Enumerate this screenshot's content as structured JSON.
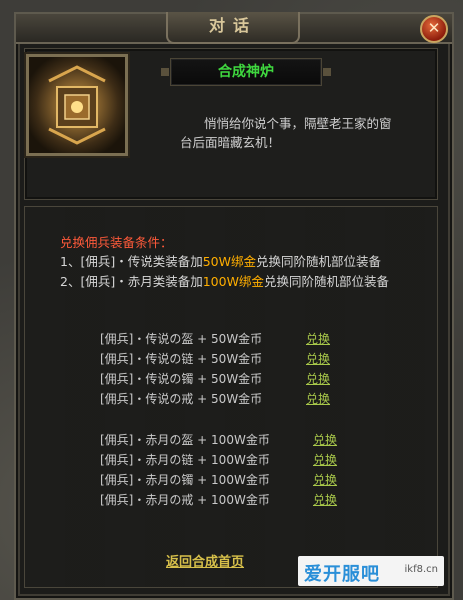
{
  "window": {
    "title": "对话",
    "close_glyph": "✕"
  },
  "npc": {
    "name": "合成神炉",
    "speech": "悄悄给你说个事，隔壁老王家的窗台后面暗藏玄机！",
    "portrait_icon": "treasure-furnace-icon"
  },
  "conditions": {
    "title": "兑换佣兵装备条件：",
    "lines": [
      {
        "prefix": "1、[佣兵]・传说类装备加",
        "highlight": "50W绑金",
        "suffix": "兑换同阶随机部位装备"
      },
      {
        "prefix": "2、[佣兵]・赤月类装备加",
        "highlight": "100W绑金",
        "suffix": "兑换同阶随机部位装备"
      }
    ]
  },
  "exchange_groups": [
    {
      "items": [
        {
          "label": "[佣兵]・传说の盔 + 50W金币",
          "action": "兑换"
        },
        {
          "label": "[佣兵]・传说の链 + 50W金币",
          "action": "兑换"
        },
        {
          "label": "[佣兵]・传说の镯 + 50W金币",
          "action": "兑换"
        },
        {
          "label": "[佣兵]・传说の戒 + 50W金币",
          "action": "兑换"
        }
      ]
    },
    {
      "items": [
        {
          "label": "[佣兵]・赤月の盔 + 100W金币",
          "action": "兑换"
        },
        {
          "label": "[佣兵]・赤月の链 + 100W金币",
          "action": "兑换"
        },
        {
          "label": "[佣兵]・赤月の镯 + 100W金币",
          "action": "兑换"
        },
        {
          "label": "[佣兵]・赤月の戒 + 100W金币",
          "action": "兑换"
        }
      ]
    }
  ],
  "footer": {
    "back_label": "返回合成首页"
  },
  "watermark": {
    "logo": "爱开服吧",
    "url": "ikf8.cn"
  },
  "colors": {
    "npc_name": "#3fd83f",
    "condition_title": "#ff5a3a",
    "highlight": "#ffae00",
    "option_link": "#a8c84a",
    "back_link": "#d7c04a"
  }
}
